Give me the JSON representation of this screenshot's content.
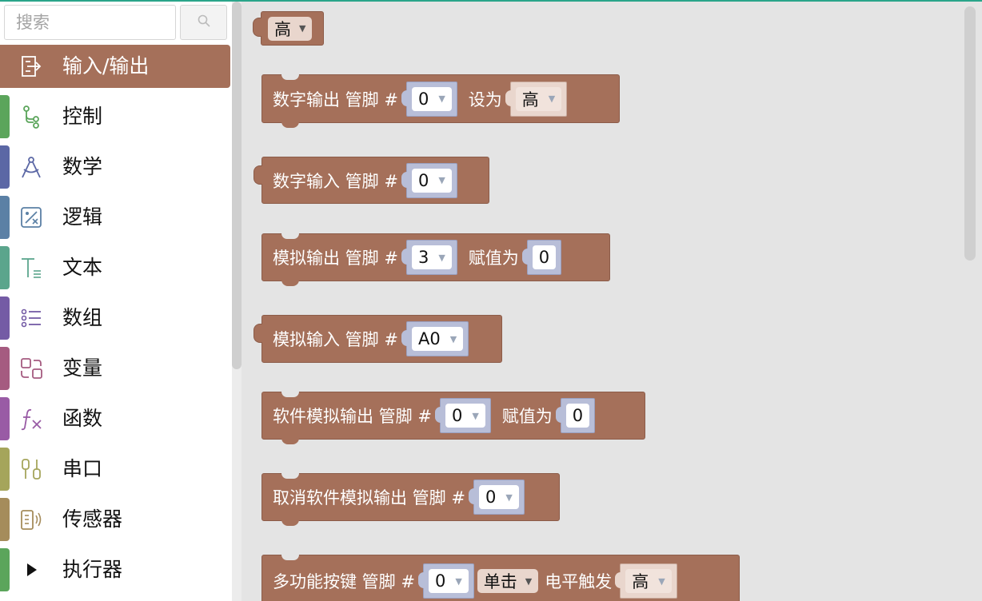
{
  "search": {
    "placeholder": "搜索"
  },
  "categories": [
    {
      "label": "输入/输出",
      "icon": "input-output-icon",
      "color": "#a5705a",
      "selected": true
    },
    {
      "label": "控制",
      "icon": "control-flow-icon",
      "color": "#5ba55b"
    },
    {
      "label": "数学",
      "icon": "compass-icon",
      "color": "#5b67a5"
    },
    {
      "label": "逻辑",
      "icon": "logic-icon",
      "color": "#5b80a5"
    },
    {
      "label": "文本",
      "icon": "text-icon",
      "color": "#5ba58c"
    },
    {
      "label": "数组",
      "icon": "list-icon",
      "color": "#745ba5"
    },
    {
      "label": "变量",
      "icon": "variable-icon",
      "color": "#a55b80"
    },
    {
      "label": "函数",
      "icon": "function-icon",
      "color": "#995ba5"
    },
    {
      "label": "串口",
      "icon": "serial-port-icon",
      "color": "#a5a55b"
    },
    {
      "label": "传感器",
      "icon": "sensor-icon",
      "color": "#a58c5b"
    },
    {
      "label": "执行器",
      "icon": "play-icon",
      "color": "#5ba55b"
    }
  ],
  "blocks": {
    "level": {
      "value": "高"
    },
    "digital_write": {
      "text": "数字输出 管脚 #",
      "pin": "0",
      "set_label": "设为",
      "value": "高"
    },
    "digital_read": {
      "text": "数字输入 管脚 #",
      "pin": "0"
    },
    "analog_write": {
      "text": "模拟输出 管脚 #",
      "pin": "3",
      "assign_label": "赋值为",
      "value": "0"
    },
    "analog_read": {
      "text": "模拟输入 管脚 #",
      "pin": "A0"
    },
    "soft_analog_write": {
      "text": "软件模拟输出 管脚 #",
      "pin": "0",
      "assign_label": "赋值为",
      "value": "0"
    },
    "cancel_soft_analog": {
      "text": "取消软件模拟输出 管脚 #",
      "pin": "0"
    },
    "multi_button": {
      "text": "多功能按键 管脚 #",
      "pin": "0",
      "mode": "单击",
      "trigger_label": "电平触发",
      "level": "高"
    }
  }
}
